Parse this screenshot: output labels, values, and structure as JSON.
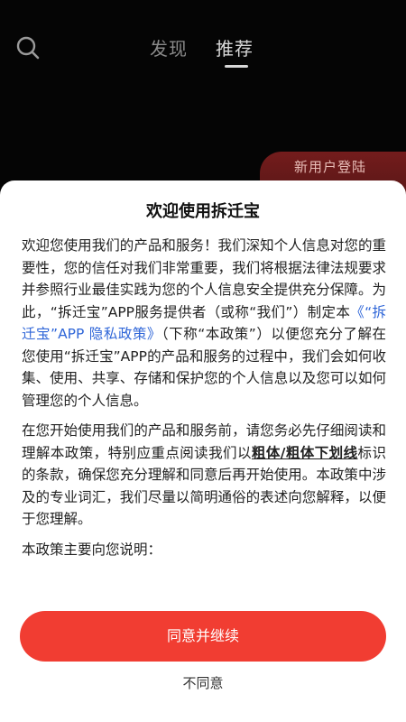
{
  "topbar": {
    "tabs": [
      {
        "label": "发现",
        "active": false
      },
      {
        "label": "推荐",
        "active": true
      }
    ]
  },
  "promo": {
    "title": "新用户登陆"
  },
  "dialog": {
    "title": "欢迎使用拆迁宝",
    "p1_a": "欢迎您使用我们的产品和服务！我们深知个人信息对您的重要性，您的信任对我们非常重要，我们将根据法律法规要求并参照行业最佳实践为您的个人信息安全提供充分保障。为此，“拆迁宝”APP服务提供者（或称“我们”）制定本",
    "policy_link": "《“拆迁宝”APP 隐私政策》",
    "p1_b": "（下称“本政策”）以便您充分了解在您使用“拆迁宝”APP的产品和服务的过程中，我们会如何收集、使用、共享、存储和保护您的个人信息以及您可以如何管理您的个人信息。",
    "p2_a": "在您开始使用我们的产品和服务前，请您务必先仔细阅读和理解本政策，特别应重点阅读我们以",
    "p2_bold": "粗体/粗体下划线",
    "p2_b": "标识的条款，确保您充分理解和同意后再开始使用。本政策中涉及的专业词汇，我们尽量以简明通俗的表述向您解释，以便于您理解。",
    "p3": "本政策主要向您说明：",
    "agree_label": "同意并继续",
    "disagree_label": "不同意"
  },
  "colors": {
    "accent": "#f13d32",
    "link": "#2f66d8"
  },
  "icons": {
    "search": "search-icon"
  }
}
